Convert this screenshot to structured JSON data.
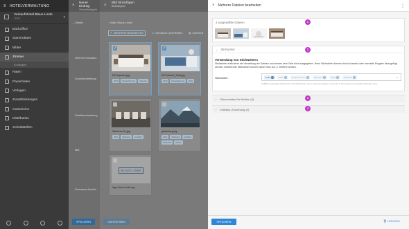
{
  "sidebar": {
    "header": "HOTELVERWALTUNG",
    "hotel_name": "Verkaufshotel Blaue Linde",
    "hotel_sub": "TEST",
    "items": [
      {
        "label": "Backoffice"
      },
      {
        "label": "Stammdaten"
      },
      {
        "label": "Bilder"
      },
      {
        "label": "Zimmer"
      },
      {
        "label": "Raten"
      },
      {
        "label": "Pauschalen"
      },
      {
        "label": "Vorlagen"
      },
      {
        "label": "Zusatzleistungen"
      },
      {
        "label": "Gutscheine"
      },
      {
        "label": "Distribution"
      },
      {
        "label": "Schnittstellen"
      }
    ],
    "subitem": "Kontingent"
  },
  "panel1": {
    "title": "Neuer Eintrag",
    "subtitle": "Zimmerkategorie",
    "details": "Details",
    "labels": [
      "Interner Kurzname",
      "Kurzbeschreibung",
      "Detailbeschreibung",
      "Bild",
      "Panorama Ansicht"
    ],
    "save": "SPEICHERN"
  },
  "panel2": {
    "title": "Bild hinzufügen",
    "subtitle": "Bildkategorie",
    "folder": "Hotel: Blaue Linde",
    "tools": [
      "MEHRERE BEARBEITEN",
      "AUSWAHL AUFHEBEN",
      "DATEIEN"
    ],
    "cards": [
      {
        "name": "D2-Superior.jpg",
        "tags": [
          "2020",
          "Doppelzimmer",
          "Superior"
        ],
        "selected": true
      },
      {
        "name": "D2-Komfort_Sofa.jpg",
        "tags": [
          "2020",
          "Doppelzimmer",
          "Sofa"
        ],
        "selected": true
      },
      {
        "name": "Wellness-01.jpg",
        "tags": [
          "2021",
          "Wellness",
          "Ausblick"
        ],
        "selected": false
      },
      {
        "name": "gletscher.jpeg",
        "tags": [
          "2021",
          "Wellness",
          "Ausblick",
          "Gletscher",
          "Winter"
        ],
        "selected": false
      },
      {
        "name": "logo-blaue-linde.svg",
        "tags": [],
        "selected": false
      }
    ],
    "logo_text": "BLAUE LINDE",
    "save": "ÜBERNEHMEN"
  },
  "editor": {
    "title": "Mehrere Dateien bearbeiten",
    "selected_count": "4 ausgewählte Dateien",
    "keywords_section": "Stichwörter",
    "keywords_heading": "Verwendung von Stichwörtern",
    "keywords_desc": "Stichwörter erleichtern die Verwaltung der Dateien und werden dem Gast nicht ausgegeben. Neue Stichwörter können durch Auswahl oder manuelle Eingabe hinzugefügt werden, bestehende Stichwörter können durch Klick auf „x“ entfernt werden.",
    "keywords_label": "Stichwörter:",
    "chips": [
      {
        "label": "2020",
        "dim": false
      },
      {
        "label": "2021",
        "dim": true
      },
      {
        "label": "Doppelzimmer",
        "dim": true
      },
      {
        "label": "Wellness",
        "dim": true
      },
      {
        "label": "Sofa",
        "dim": true
      },
      {
        "label": "Wellness",
        "dim": true
      }
    ],
    "keywords_hint": "Hellblau angezeigte Stichwörter sind Stichwörter, die in einzelnen Dateien und nicht in der gesamten Auswahl vorhanden sind.",
    "accordions": [
      "Saisonzeiten für Medien (3)",
      "Indikator-Zuordnung (4)"
    ],
    "badges": [
      "1",
      "2",
      "3",
      "4"
    ],
    "save": "SPEICHERN",
    "delete": "LÖSCHEN",
    "accent": "#c13ac9",
    "primary": "#2f86d6"
  }
}
